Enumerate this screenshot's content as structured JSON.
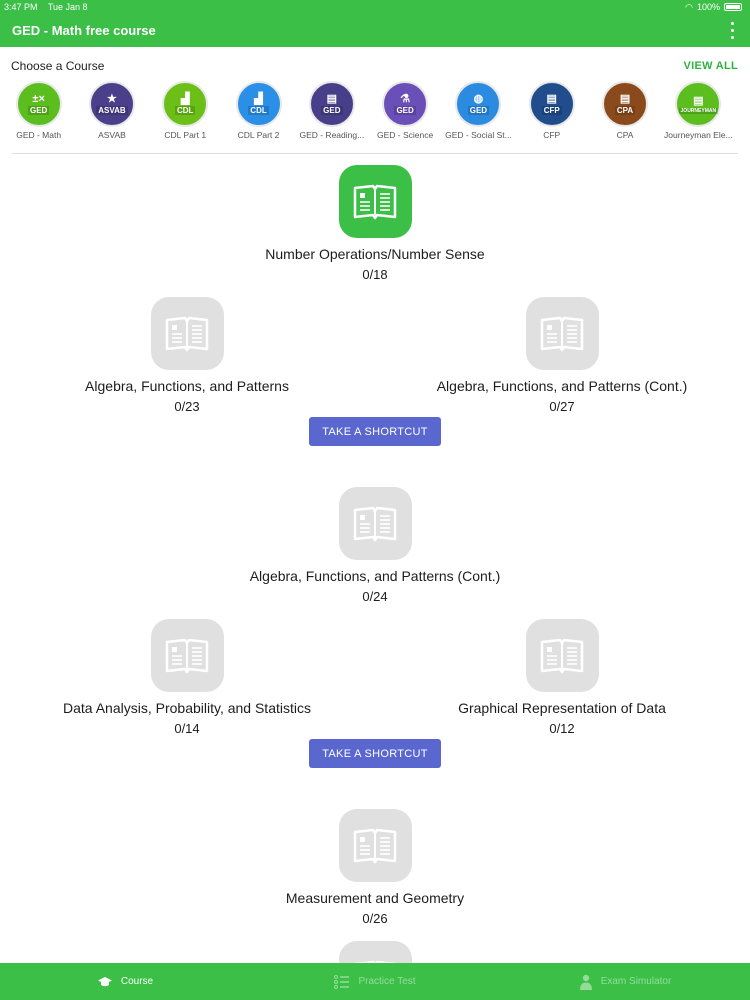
{
  "status_bar": {
    "time": "3:47 PM",
    "date": "Tue Jan 8",
    "battery": "100%"
  },
  "header": {
    "title": "GED - Math free course"
  },
  "chooser": {
    "title": "Choose a Course",
    "view_all": "VIEW ALL",
    "courses": [
      {
        "label": "GED - Math",
        "abbr": "GED",
        "glyph": "±×",
        "color": "#5cbd1f"
      },
      {
        "label": "ASVAB",
        "abbr": "ASVAB",
        "glyph": "★",
        "color": "#4a3f8a"
      },
      {
        "label": "CDL Part 1",
        "abbr": "CDL",
        "glyph": "▟",
        "color": "#6cbf17"
      },
      {
        "label": "CDL Part 2",
        "abbr": "CDL",
        "glyph": "▟",
        "color": "#2a8fe6"
      },
      {
        "label": "GED - Reading...",
        "abbr": "GED",
        "glyph": "▤",
        "color": "#473f8a"
      },
      {
        "label": "GED - Science",
        "abbr": "GED",
        "glyph": "⚗",
        "color": "#6a4fb8"
      },
      {
        "label": "GED - Social St...",
        "abbr": "GED",
        "glyph": "◍",
        "color": "#2b8be0"
      },
      {
        "label": "CFP",
        "abbr": "CFP",
        "glyph": "▤",
        "color": "#214d8c"
      },
      {
        "label": "CPA",
        "abbr": "CPA",
        "glyph": "▤",
        "color": "#8a4a1c"
      },
      {
        "label": "Journeyman Ele...",
        "abbr": "JOURNEYMAN",
        "glyph": "▤",
        "color": "#5cbd1f"
      }
    ]
  },
  "path": {
    "nodes": [
      {
        "title": "Number Operations/Number Sense",
        "count": "0/18",
        "active": true
      },
      {
        "title": "Algebra, Functions, and Patterns",
        "count": "0/23",
        "active": false
      },
      {
        "title": "Algebra, Functions, and Patterns (Cont.)",
        "count": "0/27",
        "active": false
      },
      {
        "title": "Algebra, Functions, and Patterns (Cont.)",
        "count": "0/24",
        "active": false
      },
      {
        "title": "Data Analysis, Probability, and Statistics",
        "count": "0/14",
        "active": false
      },
      {
        "title": "Graphical Representation of Data",
        "count": "0/12",
        "active": false
      },
      {
        "title": "Measurement and Geometry",
        "count": "0/26",
        "active": false
      }
    ],
    "shortcut_label": "TAKE A SHORTCUT"
  },
  "tabbar": {
    "tabs": [
      {
        "label": "Course",
        "icon": "graduation-cap-icon",
        "active": true
      },
      {
        "label": "Practice Test",
        "icon": "list-icon",
        "active": false
      },
      {
        "label": "Exam Simulator",
        "icon": "person-icon",
        "active": false
      }
    ]
  }
}
